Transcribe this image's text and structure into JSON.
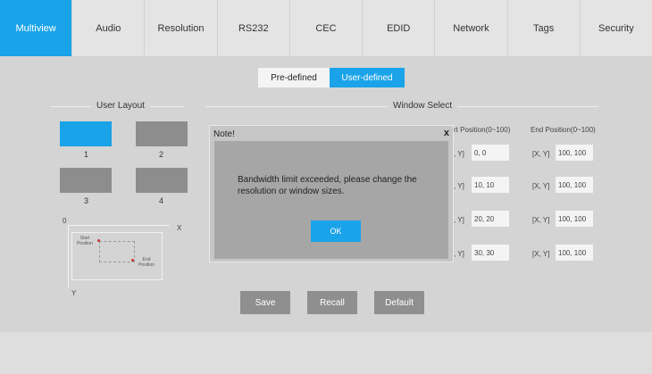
{
  "tabs": [
    "Multiview",
    "Audio",
    "Resolution",
    "RS232",
    "CEC",
    "EDID",
    "Network",
    "Tags",
    "Security"
  ],
  "mode": {
    "predefined": "Pre-defined",
    "userdefined": "User-defined"
  },
  "user_layout": {
    "title": "User Layout",
    "layouts": [
      "1",
      "2",
      "3",
      "4"
    ],
    "diagram": {
      "origin": "0",
      "x": "X",
      "y": "Y",
      "start": "Start Position",
      "end": "End Position"
    }
  },
  "window_select": {
    "title": "Window Select",
    "start_header": "rt Position(0~100)",
    "end_header": "End Position(0~100)",
    "rows": [
      {
        "start_label": ", Y]",
        "start": "0, 0",
        "end_label": "[X, Y]",
        "end": "100, 100"
      },
      {
        "start_label": ", Y]",
        "start": "10, 10",
        "end_label": "[X, Y]",
        "end": "100, 100"
      },
      {
        "start_label": ", Y]",
        "start": "20, 20",
        "end_label": "[X, Y]",
        "end": "100, 100"
      },
      {
        "start_label": ", Y]",
        "start": "30, 30",
        "end_label": "[X, Y]",
        "end": "100, 100"
      }
    ]
  },
  "buttons": {
    "save": "Save",
    "recall": "Recall",
    "default": "Default"
  },
  "dialog": {
    "title": "Note!",
    "close": "x",
    "message": "Bandwidth limit exceeded, please change the resolution or window sizes.",
    "ok": "OK"
  },
  "colors": {
    "accent": "#1aa3e8"
  }
}
